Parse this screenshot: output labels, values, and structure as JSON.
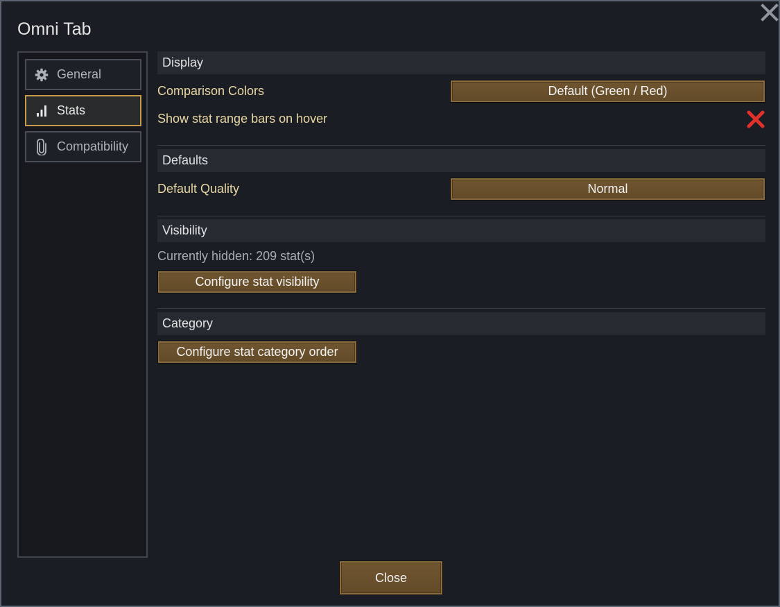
{
  "window": {
    "title": "Omni Tab"
  },
  "sidebar": {
    "items": [
      {
        "label": "General",
        "icon": "gear-icon"
      },
      {
        "label": "Stats",
        "icon": "bar-chart-icon",
        "active": true
      },
      {
        "label": "Compatibility",
        "icon": "paperclip-icon"
      }
    ]
  },
  "sections": {
    "display": {
      "header": "Display",
      "comparison_colors_label": "Comparison Colors",
      "comparison_colors_value": "Default (Green / Red)",
      "range_bars_label": "Show stat range bars on hover",
      "range_bars_enabled": false
    },
    "defaults": {
      "header": "Defaults",
      "default_quality_label": "Default Quality",
      "default_quality_value": "Normal"
    },
    "visibility": {
      "header": "Visibility",
      "hidden_text": "Currently hidden: 209 stat(s)",
      "configure_button": "Configure stat visibility"
    },
    "category": {
      "header": "Category",
      "configure_button": "Configure stat category order"
    }
  },
  "footer": {
    "close_label": "Close"
  },
  "colors": {
    "accent_gold": "#c99a4a",
    "button_brown": "#6b522c",
    "label_yellow": "#e8d6a3",
    "disabled_red": "#e0312a"
  }
}
